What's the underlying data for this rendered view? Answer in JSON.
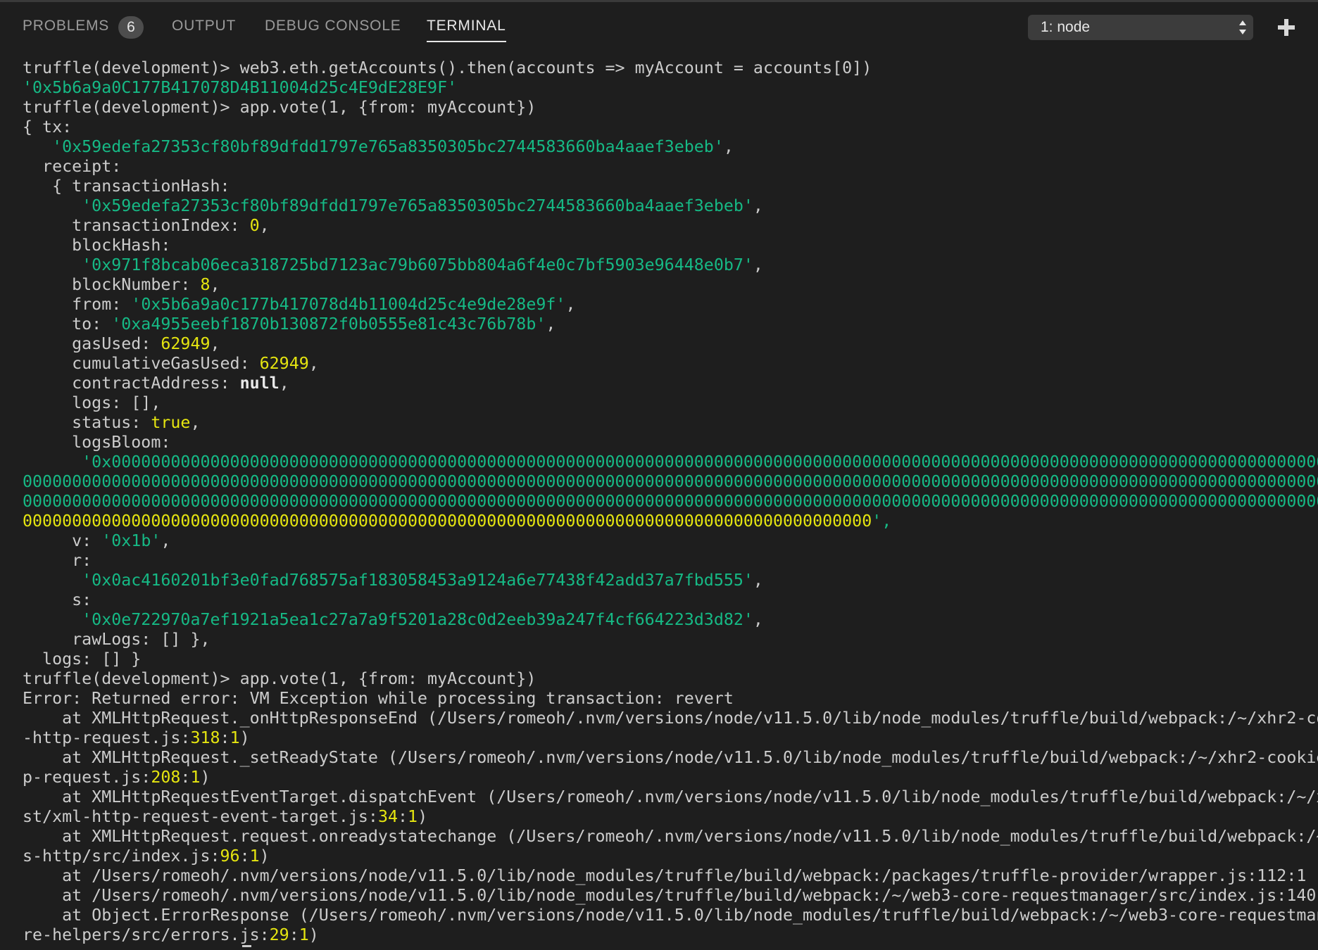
{
  "panel": {
    "tabs": [
      {
        "label": "PROBLEMS",
        "badge": "6"
      },
      {
        "label": "OUTPUT"
      },
      {
        "label": "DEBUG CONSOLE"
      },
      {
        "label": "TERMINAL",
        "active": true
      }
    ],
    "terminal_select": "1: node",
    "icons": {
      "add": "plus-icon",
      "select_arrows": "updown-arrows-icon"
    }
  },
  "colors": {
    "background": "#1e1e1e",
    "text": "#cccccc",
    "string": "#16b985",
    "number": "#e5e510"
  },
  "terminal": {
    "lines": [
      "truffle(development)> web3.eth.getAccounts().then(accounts => myAccount = accounts[0])",
      "'0x5b6a9a0C177B417078D4B11004d25c4E9dE28E9F'",
      "truffle(development)> app.vote(1, {from: myAccount})",
      "{ tx:",
      "   '0x59edefa27353cf80bf89dfdd1797e765a8350305bc2744583660ba4aaef3ebeb',",
      "  receipt:",
      "   { transactionHash:",
      "      '0x59edefa27353cf80bf89dfdd1797e765a8350305bc2744583660ba4aaef3ebeb',",
      "     transactionIndex: 0,",
      "     blockHash:",
      "      '0x971f8bcab06eca318725bd7123ac79b6075bb804a6f4e0c7bf5903e96448e0b7',",
      "     blockNumber: 8,",
      "     from: '0x5b6a9a0c177b417078d4b11004d25c4e9de28e9f',",
      "     to: '0xa4955eebf1870b130872f0b0555e81c43c76b78b',",
      "     gasUsed: 62949,",
      "     cumulativeGasUsed: 62949,",
      "     contractAddress: null,",
      "     logs: [],",
      "     status: true,",
      "     logsBloom:",
      "      '0x000000000000000000000000000000000000000000000000000000000000000000000000000000000000000000000000000000000000000000000000000000",
      "000000000000000000000000000000000000000000000000000000000000000000000000000000000000000000000000000000000000000000000000000000000000",
      "000000000000000000000000000000000000000000000000000000000000000000000000000000000000000000000000000000000000000000000000000000000000",
      "00000000000000000000000000000000000000000000000000000000000000000000000000000000000000',",
      "     v: '0x1b',",
      "     r:",
      "      '0x0ac4160201bf3e0fad768575af183058453a9124a6e77438f42add37a7fbd555',",
      "     s:",
      "      '0x0e722970a7ef1921a5ea1c27a7a9f5201a28c0d2eeb39a247f4cf664223d3d82',",
      "     rawLogs: [] },",
      "  logs: [] }",
      "truffle(development)> app.vote(1, {from: myAccount})",
      "Error: Returned error: VM Exception while processing transaction: revert",
      "    at XMLHttpRequest._onHttpResponseEnd (/Users/romeoh/.nvm/versions/node/v11.5.0/lib/node_modules/truffle/build/webpack:/~/xhr2-co",
      "-http-request.js:318:1)",
      "    at XMLHttpRequest._setReadyState (/Users/romeoh/.nvm/versions/node/v11.5.0/lib/node_modules/truffle/build/webpack:/~/xhr2-cookie",
      "p-request.js:208:1)",
      "    at XMLHttpRequestEventTarget.dispatchEvent (/Users/romeoh/.nvm/versions/node/v11.5.0/lib/node_modules/truffle/build/webpack:/~/x",
      "st/xml-http-request-event-target.js:34:1)",
      "    at XMLHttpRequest.request.onreadystatechange (/Users/romeoh/.nvm/versions/node/v11.5.0/lib/node_modules/truffle/build/webpack:/~",
      "s-http/src/index.js:96:1)",
      "    at /Users/romeoh/.nvm/versions/node/v11.5.0/lib/node_modules/truffle/build/webpack:/packages/truffle-provider/wrapper.js:112:1",
      "    at /Users/romeoh/.nvm/versions/node/v11.5.0/lib/node_modules/truffle/build/webpack:/~/web3-core-requestmanager/src/index.js:140",
      "    at Object.ErrorResponse (/Users/romeoh/.nvm/versions/node/v11.5.0/lib/node_modules/truffle/build/webpack:/~/web3-core-requestman",
      "re-helpers/src/errors.js:29:1)"
    ]
  }
}
